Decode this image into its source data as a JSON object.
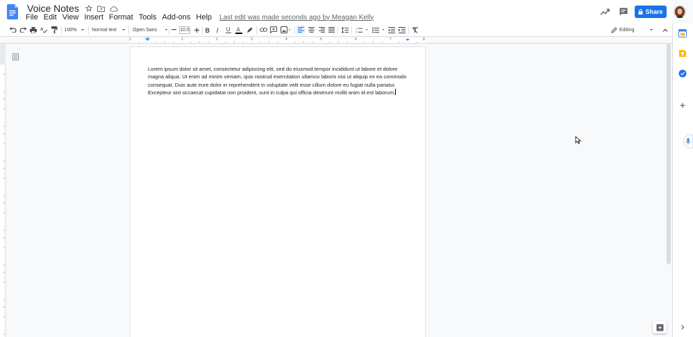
{
  "header": {
    "doc_title": "Voice Notes",
    "menu": [
      "File",
      "Edit",
      "View",
      "Insert",
      "Format",
      "Tools",
      "Add-ons",
      "Help"
    ],
    "last_edit": "Last edit was made seconds ago by Meagan Kelly",
    "share_label": "Share"
  },
  "toolbar": {
    "zoom": "100%",
    "style": "Normal text",
    "font": "Open Sans",
    "font_size": "10.5",
    "mode": "Editing"
  },
  "ruler": {
    "numbers": [
      "1",
      "1",
      "2",
      "3",
      "4",
      "5",
      "6",
      "7",
      "8"
    ]
  },
  "document": {
    "body": "Lorem ipsum dolor sit amet, consectetur adipiscing elit, sed do eiusmod tempor incididunt ut labore et dolore magna aliqua. Ut enim ad minim veniam, quis nostrud exercitation ullamco laboris nisi ut aliquip ex ea commodo consequat. Duis aute irure dolor in reprehenderit in voluptate velit esse cillum dolore eu fugiat nulla pariatur. Excepteur sint occaecat cupidatat non proident, sunt in culpa qui officia deserunt mollit anim id est laborum."
  },
  "colors": {
    "brand_blue": "#1a73e8",
    "docs_blue": "#4285f4",
    "keep_yellow": "#fbbc04"
  }
}
